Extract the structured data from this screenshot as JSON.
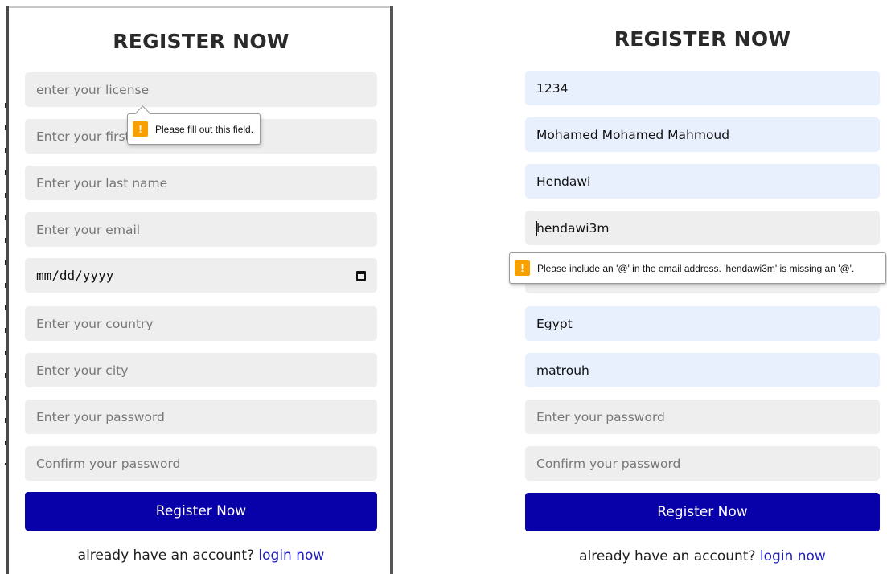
{
  "left_form": {
    "title": "REGISTER NOW",
    "fields": [
      {
        "placeholder": "enter your license",
        "value": ""
      },
      {
        "placeholder": "Enter your first name",
        "value": ""
      },
      {
        "placeholder": "Enter your last name",
        "value": ""
      },
      {
        "placeholder": "Enter your email",
        "value": ""
      },
      {
        "placeholder": "mm/dd/yyyy",
        "value": ""
      },
      {
        "placeholder": "Enter your country",
        "value": ""
      },
      {
        "placeholder": "Enter your city",
        "value": ""
      },
      {
        "placeholder": "Enter your password",
        "value": ""
      },
      {
        "placeholder": "Confirm your password",
        "value": ""
      }
    ],
    "visible_first_name_text": "Enter your first",
    "date_text": "mm/dd/yyyy",
    "tooltip_text": "Please fill out this field.",
    "submit_label": "Register Now",
    "footer_text": "already have an account?",
    "login_link": "login now"
  },
  "right_form": {
    "title": "REGISTER NOW",
    "license_value": "1234",
    "first_name_value": "Mohamed Mohamed Mahmoud",
    "last_name_value": "Hendawi",
    "email_value": "hendawi3m",
    "country_value": "Egypt",
    "city_value": "matrouh",
    "password_placeholder": "Enter your password",
    "confirm_placeholder": "Confirm your password",
    "tooltip_text": "Please include an '@' in the email address. 'hendawi3m' is missing an '@'.",
    "submit_label": "Register Now",
    "footer_text": "already have an account?",
    "login_link": "login now"
  },
  "icons": {
    "warning": "warning-icon",
    "calendar": "calendar-icon"
  },
  "colors": {
    "button": "#0800a8",
    "link": "#2020b8",
    "warning": "#f7a000",
    "autofill": "#e8f0fe"
  }
}
